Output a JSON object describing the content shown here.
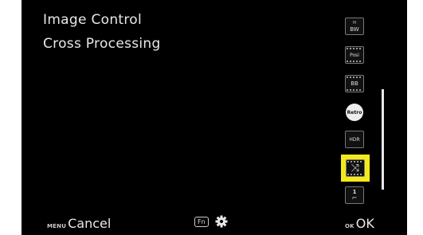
{
  "screen": {
    "title_line1": "Image Control",
    "title_line2": "Cross Processing"
  },
  "icons": [
    {
      "name": "bw-icon",
      "top_text": "H",
      "text": "BW",
      "selected": false
    },
    {
      "name": "posi-icon",
      "text": "Posi",
      "selected": false
    },
    {
      "name": "bleach-bypass-icon",
      "text": "BB",
      "selected": false
    },
    {
      "name": "retro-icon",
      "text": "Retro",
      "selected": false
    },
    {
      "name": "hdr-icon",
      "text": "HDR",
      "selected": false
    },
    {
      "name": "cross-processing-icon",
      "text": "⤨",
      "selected": true
    },
    {
      "name": "custom-1-icon",
      "text": "1",
      "selected": false
    }
  ],
  "bottom": {
    "menu_tag": "MENU",
    "cancel_label": "Cancel",
    "fn_tag": "Fn",
    "ok_tag": "OK",
    "ok_label": "OK"
  },
  "colors": {
    "background": "#000000",
    "highlight": "#f3ea1c",
    "text": "#e8e8e8"
  }
}
